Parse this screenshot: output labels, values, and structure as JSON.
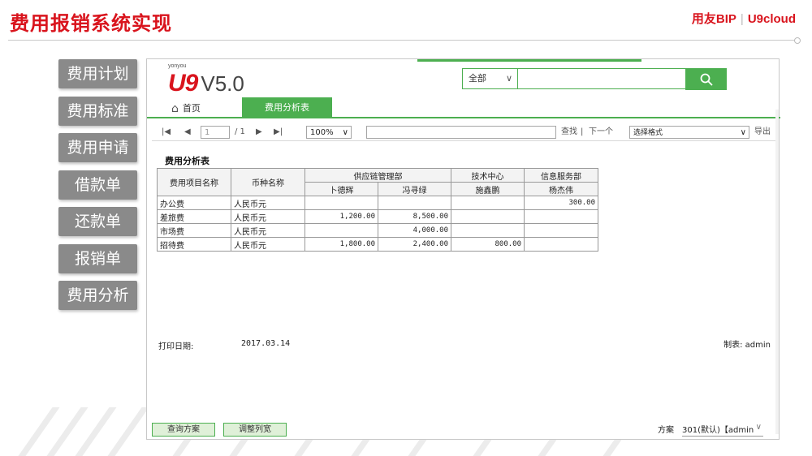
{
  "slide": {
    "title": "费用报销系统实现",
    "brand_left": "用友BIP",
    "brand_sep": "|",
    "brand_right": "U9cloud"
  },
  "menu": [
    "费用计划",
    "费用标准",
    "费用申请",
    "借款单",
    "还款单",
    "报销单",
    "费用分析"
  ],
  "app": {
    "logo_small": "yonyou",
    "logo_mark": "U9",
    "logo_version": "V5.0",
    "search": {
      "scope": "全部",
      "placeholder": ""
    },
    "tabs": {
      "home": "首页",
      "active": "费用分析表"
    },
    "toolbar": {
      "first": "|◀",
      "prev": "◀",
      "page_input": "1",
      "page_total": "/ 1",
      "next": "▶",
      "last": "▶|",
      "zoom": "100%",
      "find": "查找",
      "divider": "|",
      "next_match": "下一个",
      "format": "选择格式",
      "export": "导出"
    },
    "report": {
      "title": "费用分析表",
      "headers": {
        "item": "费用项目名称",
        "currency": "币种名称",
        "dept_supply": "供应链管理部",
        "dept_tech": "技术中心",
        "dept_info": "信息服务部",
        "p1": "卜德辉",
        "p2": "冯寻绿",
        "p3": "施鑫鹏",
        "p4": "杨杰伟"
      },
      "rows": [
        {
          "item": "办公费",
          "currency": "人民币元",
          "v1": "",
          "v2": "",
          "v3": "",
          "v4": "300.00"
        },
        {
          "item": "差旅费",
          "currency": "人民币元",
          "v1": "1,200.00",
          "v2": "8,500.00",
          "v3": "",
          "v4": ""
        },
        {
          "item": "市场费",
          "currency": "人民币元",
          "v1": "",
          "v2": "4,000.00",
          "v3": "",
          "v4": ""
        },
        {
          "item": "招待费",
          "currency": "人民币元",
          "v1": "1,800.00",
          "v2": "2,400.00",
          "v3": "800.00",
          "v4": ""
        }
      ],
      "print_date_label": "打印日期:",
      "print_date": "2017.03.14",
      "maker_label": "制表: admin"
    },
    "bottom": {
      "query_plan": "查询方案",
      "adjust_width": "调整列宽",
      "scheme_label": "方案",
      "scheme_value": "301(默认)【admin"
    }
  }
}
